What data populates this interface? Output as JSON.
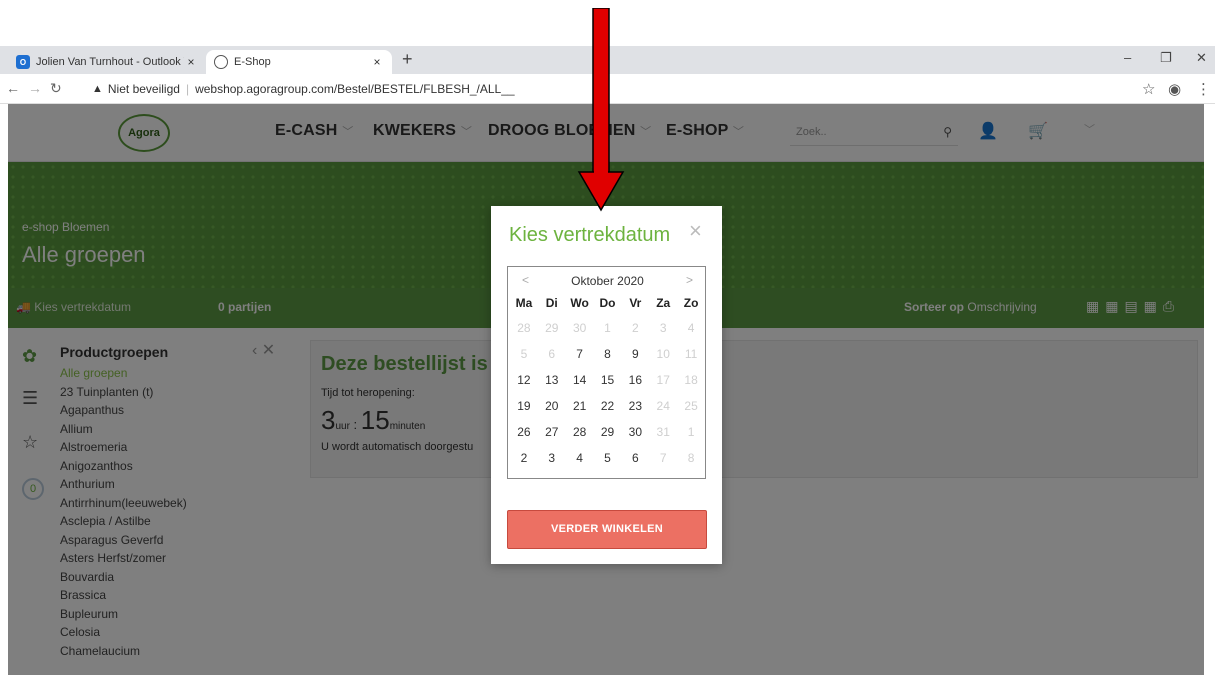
{
  "browser": {
    "tabs": [
      {
        "title": "Jolien Van Turnhout - Outlook W",
        "icon": "outlook-icon",
        "close": "×"
      },
      {
        "title": "E-Shop",
        "icon": "globe-icon",
        "close": "×"
      }
    ],
    "new_tab": "+",
    "window_controls": [
      "–",
      "❐",
      "✕"
    ],
    "security": "Niet beveiligd",
    "url": "webshop.agoragroup.com/Bestel/BESTEL/FLBESH_/ALL__"
  },
  "site": {
    "logo": "Agora",
    "nav": [
      "E-CASH",
      "KWEKERS",
      "DROOG BLOEMEN",
      "E-SHOP"
    ],
    "search_placeholder": "Zoek..",
    "hero_sub": "e-shop Bloemen",
    "hero_title": "Alle groepen",
    "filter_dropdown": "Kies vertrekdatum",
    "count": "0 partijen",
    "sort_label": "Sorteer op",
    "sort_value": "Omschrijving"
  },
  "sidebar": {
    "title": "Productgroepen",
    "items": [
      "Alle groepen",
      "23 Tuinplanten (t)",
      "Agapanthus",
      "Allium",
      "Alstroemeria",
      "Anigozanthos",
      "Anthurium",
      "Antirrhinum(leeuwebek)",
      "Asclepia / Astilbe",
      "Asparagus Geverfd",
      "Asters Herfst/zomer",
      "Bouvardia",
      "Brassica",
      "Bupleurum",
      "Celosia",
      "Chamelaucium"
    ],
    "counter": "0"
  },
  "notice": {
    "heading": "Deze bestellijst is d",
    "label": "Tijd tot heropening:",
    "hours": "3",
    "hours_unit": "uur",
    "minutes": "15",
    "minutes_unit": "minuten",
    "footer": "U wordt automatisch doorgestu"
  },
  "modal": {
    "title": "Kies vertrekdatum",
    "close": "×",
    "month": "Oktober 2020",
    "prev": "<",
    "next": ">",
    "weekdays": [
      "Ma",
      "Di",
      "Wo",
      "Do",
      "Vr",
      "Za",
      "Zo"
    ],
    "days": [
      {
        "d": "28",
        "muted": true
      },
      {
        "d": "29",
        "muted": true
      },
      {
        "d": "30",
        "muted": true
      },
      {
        "d": "1",
        "muted": true
      },
      {
        "d": "2",
        "muted": true
      },
      {
        "d": "3",
        "muted": true
      },
      {
        "d": "4",
        "muted": true
      },
      {
        "d": "5",
        "muted": true
      },
      {
        "d": "6",
        "muted": true
      },
      {
        "d": "7",
        "muted": false
      },
      {
        "d": "8",
        "muted": false
      },
      {
        "d": "9",
        "muted": false
      },
      {
        "d": "10",
        "muted": true
      },
      {
        "d": "11",
        "muted": true
      },
      {
        "d": "12",
        "muted": false
      },
      {
        "d": "13",
        "muted": false
      },
      {
        "d": "14",
        "muted": false
      },
      {
        "d": "15",
        "muted": false
      },
      {
        "d": "16",
        "muted": false
      },
      {
        "d": "17",
        "muted": true
      },
      {
        "d": "18",
        "muted": true
      },
      {
        "d": "19",
        "muted": false
      },
      {
        "d": "20",
        "muted": false
      },
      {
        "d": "21",
        "muted": false
      },
      {
        "d": "22",
        "muted": false
      },
      {
        "d": "23",
        "muted": false
      },
      {
        "d": "24",
        "muted": true
      },
      {
        "d": "25",
        "muted": true
      },
      {
        "d": "26",
        "muted": false
      },
      {
        "d": "27",
        "muted": false
      },
      {
        "d": "28",
        "muted": false
      },
      {
        "d": "29",
        "muted": false
      },
      {
        "d": "30",
        "muted": false
      },
      {
        "d": "31",
        "muted": true
      },
      {
        "d": "1",
        "muted": true
      },
      {
        "d": "2",
        "muted": false
      },
      {
        "d": "3",
        "muted": false
      },
      {
        "d": "4",
        "muted": false
      },
      {
        "d": "5",
        "muted": false
      },
      {
        "d": "6",
        "muted": false
      },
      {
        "d": "7",
        "muted": true
      },
      {
        "d": "8",
        "muted": true
      }
    ],
    "button": "VERDER WINKELEN"
  },
  "colors": {
    "brand_green": "#5d9a44",
    "title_green": "#6db33f",
    "button_red": "#ec7063",
    "arrow_red": "#e00000"
  }
}
